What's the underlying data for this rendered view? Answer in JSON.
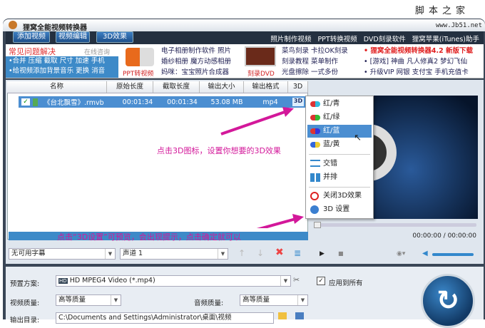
{
  "watermark": {
    "site_cn": "脚本之家",
    "url": "www.Jb51.net"
  },
  "window": {
    "title": "狸窝全能视频转换器"
  },
  "toolbar": {
    "buttons": [
      "添加视频",
      "视频编辑",
      "3D效果"
    ],
    "links": [
      "照片制作视频",
      "PPT转换视频",
      "DVD刻录软件",
      "狸窝苹果(iTunes)助手"
    ]
  },
  "banner": {
    "faq_title": "常见问题解决",
    "faq_online": "在线咨询",
    "faq_line1": "•合并 压缩 截取 尺寸 加速 手机",
    "faq_line2": "•给视频添加背景音乐 更换 消音",
    "ppt_label": "PPT转视频",
    "ppt_links": [
      "电子相册制作软件 照片",
      "婚纱相册 魔方动感相册",
      "妈咪：宝宝照片合成器"
    ],
    "dvd_label": "刻录DVD",
    "dvd_links": [
      "菜鸟刻录 卡拉OK刻录",
      "刻录教程 菜单制作",
      "光盘擦除 一式多份"
    ],
    "news": [
      "• 狸窝全能视频转换器4.2 新版下载",
      "• [游戏] 神曲 凡人修真2 梦幻飞仙",
      "• 升级VIP 网银 支付宝 手机充值卡"
    ]
  },
  "table": {
    "headers": [
      "名称",
      "原始长度",
      "截取长度",
      "输出大小",
      "输出格式",
      "3D"
    ],
    "rows": [
      {
        "name": "《台北飘雪》.rmvb",
        "original": "00:01:34",
        "clip": "00:01:34",
        "size": "53.08 MB",
        "format": "mp4",
        "checked": true
      }
    ]
  },
  "menu_3d": {
    "items": [
      "红/青",
      "红/绿",
      "红/蓝",
      "蓝/黄",
      "交错",
      "并排",
      "关闭3D效果",
      "3D 设置"
    ],
    "selected": "红/蓝"
  },
  "annotations": {
    "a1": "点击3D图标，设置你想要的3D效果",
    "a2": "点击“3D设置”可预览，会出现提示，点击确定就可以"
  },
  "player": {
    "time": "00:00:00 / 00:00:00",
    "volume": 0.9,
    "progress": 0
  },
  "subtitle": {
    "value": "无可用字幕"
  },
  "audio_track": {
    "value": "声道 1"
  },
  "settings": {
    "preset_label": "预置方案:",
    "preset_value": "HD MPEG4 Video (*.mp4)",
    "apply_all": "应用到所有",
    "apply_all_checked": true,
    "video_quality_label": "视频质量:",
    "video_quality": "高等质量",
    "audio_quality_label": "音频质量:",
    "audio_quality": "高等质量",
    "output_label": "输出目录:",
    "output_path": "C:\\Documents and Settings\\Administrator\\桌面\\视频"
  }
}
